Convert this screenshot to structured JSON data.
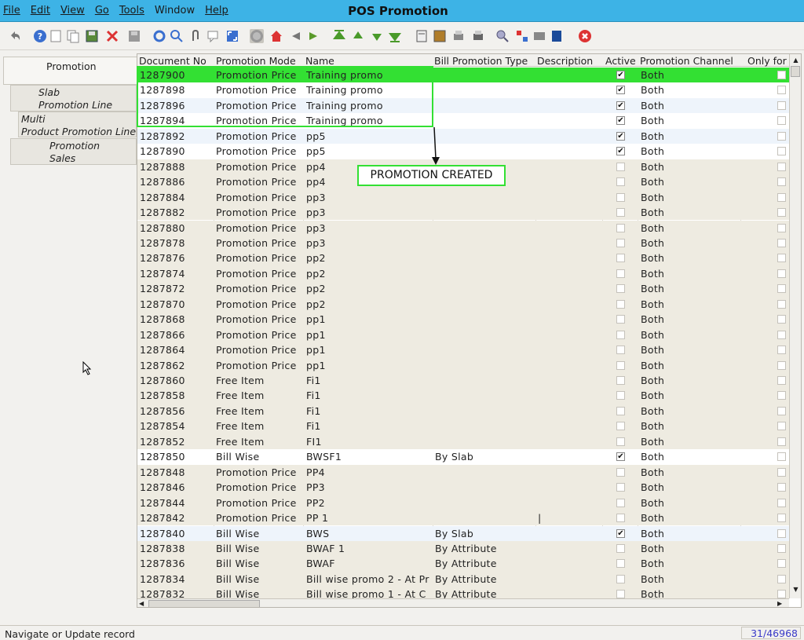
{
  "window": {
    "title": "POS Promotion"
  },
  "menu": [
    "File",
    "Edit",
    "View",
    "Go",
    "Tools",
    "Window",
    "Help"
  ],
  "toolbar_icons": [
    "undo-icon",
    "help-icon",
    "new-record-icon",
    "copy-record-icon",
    "save-record-icon",
    "delete-icon",
    "save-icon",
    "refresh-icon",
    "find-icon",
    "attachment-icon",
    "chat-icon",
    "grid-toggle-icon",
    "history-icon",
    "home-icon",
    "previous-icon",
    "next-icon",
    "first-record-icon",
    "previous-record-icon",
    "next-record-icon",
    "last-record-icon",
    "report-icon",
    "archive-icon",
    "print-preview-icon",
    "print-icon",
    "zoom-across-icon",
    "workflow-icon",
    "request-icon",
    "product-info-icon",
    "close-window-icon"
  ],
  "sidebar": {
    "tabs": [
      {
        "lines": [
          "Promotion"
        ]
      },
      {
        "lines": [
          "Slab",
          "Promotion Line"
        ]
      },
      {
        "lines": [
          "Multi",
          "Product Promotion Line"
        ]
      },
      {
        "lines": [
          "Promotion",
          "Sales"
        ]
      }
    ]
  },
  "table": {
    "columns": [
      "Document No",
      "Promotion Mode",
      "Name",
      "Bill Promotion Type",
      "Description",
      "Active",
      "Promotion Channel",
      "Only for ("
    ],
    "rows": [
      {
        "doc": "1287900",
        "mode": "Promotion Price",
        "name": "Training promo",
        "type": "",
        "desc": "",
        "active": true,
        "channel": "Both"
      },
      {
        "doc": "1287898",
        "mode": "Promotion Price",
        "name": "Training promo",
        "type": "",
        "desc": "",
        "active": true,
        "channel": "Both"
      },
      {
        "doc": "1287896",
        "mode": "Promotion Price",
        "name": "Training promo",
        "type": "",
        "desc": "",
        "active": true,
        "channel": "Both"
      },
      {
        "doc": "1287894",
        "mode": "Promotion Price",
        "name": "Training promo",
        "type": "",
        "desc": "",
        "active": true,
        "channel": "Both"
      },
      {
        "doc": "1287892",
        "mode": "Promotion Price",
        "name": "pp5",
        "type": "",
        "desc": "",
        "active": true,
        "channel": "Both"
      },
      {
        "doc": "1287890",
        "mode": "Promotion Price",
        "name": "pp5",
        "type": "",
        "desc": "",
        "active": true,
        "channel": "Both"
      },
      {
        "doc": "1287888",
        "mode": "Promotion Price",
        "name": "pp4",
        "type": "",
        "desc": "",
        "active": false,
        "channel": "Both"
      },
      {
        "doc": "1287886",
        "mode": "Promotion Price",
        "name": "pp4",
        "type": "",
        "desc": "",
        "active": false,
        "channel": "Both"
      },
      {
        "doc": "1287884",
        "mode": "Promotion Price",
        "name": "pp3",
        "type": "",
        "desc": "",
        "active": false,
        "channel": "Both"
      },
      {
        "doc": "1287882",
        "mode": "Promotion Price",
        "name": "pp3",
        "type": "",
        "desc": "",
        "active": false,
        "channel": "Both"
      },
      {
        "doc": "1287880",
        "mode": "Promotion Price",
        "name": "pp3",
        "type": "",
        "desc": "",
        "active": false,
        "channel": "Both"
      },
      {
        "doc": "1287878",
        "mode": "Promotion Price",
        "name": "pp3",
        "type": "",
        "desc": "",
        "active": false,
        "channel": "Both"
      },
      {
        "doc": "1287876",
        "mode": "Promotion Price",
        "name": "pp2",
        "type": "",
        "desc": "",
        "active": false,
        "channel": "Both"
      },
      {
        "doc": "1287874",
        "mode": "Promotion Price",
        "name": "pp2",
        "type": "",
        "desc": "",
        "active": false,
        "channel": "Both"
      },
      {
        "doc": "1287872",
        "mode": "Promotion Price",
        "name": "pp2",
        "type": "",
        "desc": "",
        "active": false,
        "channel": "Both"
      },
      {
        "doc": "1287870",
        "mode": "Promotion Price",
        "name": "pp2",
        "type": "",
        "desc": "",
        "active": false,
        "channel": "Both"
      },
      {
        "doc": "1287868",
        "mode": "Promotion Price",
        "name": "pp1",
        "type": "",
        "desc": "",
        "active": false,
        "channel": "Both"
      },
      {
        "doc": "1287866",
        "mode": "Promotion Price",
        "name": "pp1",
        "type": "",
        "desc": "",
        "active": false,
        "channel": "Both"
      },
      {
        "doc": "1287864",
        "mode": "Promotion Price",
        "name": "pp1",
        "type": "",
        "desc": "",
        "active": false,
        "channel": "Both"
      },
      {
        "doc": "1287862",
        "mode": "Promotion Price",
        "name": "pp1",
        "type": "",
        "desc": "",
        "active": false,
        "channel": "Both"
      },
      {
        "doc": "1287860",
        "mode": "Free Item",
        "name": "Fi1",
        "type": "",
        "desc": "",
        "active": false,
        "channel": "Both"
      },
      {
        "doc": "1287858",
        "mode": "Free Item",
        "name": "Fi1",
        "type": "",
        "desc": "",
        "active": false,
        "channel": "Both"
      },
      {
        "doc": "1287856",
        "mode": "Free Item",
        "name": "Fi1",
        "type": "",
        "desc": "",
        "active": false,
        "channel": "Both"
      },
      {
        "doc": "1287854",
        "mode": "Free Item",
        "name": "Fi1",
        "type": "",
        "desc": "",
        "active": false,
        "channel": "Both"
      },
      {
        "doc": "1287852",
        "mode": "Free Item",
        "name": "FI1",
        "type": "",
        "desc": "",
        "active": false,
        "channel": "Both"
      },
      {
        "doc": "1287850",
        "mode": "Bill Wise",
        "name": "BWSF1",
        "type": "By Slab",
        "desc": "",
        "active": true,
        "channel": "Both"
      },
      {
        "doc": "1287848",
        "mode": "Promotion Price",
        "name": "PP4",
        "type": "",
        "desc": "",
        "active": false,
        "channel": "Both"
      },
      {
        "doc": "1287846",
        "mode": "Promotion Price",
        "name": "PP3",
        "type": "",
        "desc": "",
        "active": false,
        "channel": "Both"
      },
      {
        "doc": "1287844",
        "mode": "Promotion Price",
        "name": "PP2",
        "type": "",
        "desc": "",
        "active": false,
        "channel": "Both"
      },
      {
        "doc": "1287842",
        "mode": "Promotion Price",
        "name": "PP 1",
        "type": "",
        "desc": "|",
        "active": false,
        "channel": "Both"
      },
      {
        "doc": "1287840",
        "mode": "Bill Wise",
        "name": "BWS",
        "type": "By Slab",
        "desc": "",
        "active": true,
        "channel": "Both"
      },
      {
        "doc": "1287838",
        "mode": "Bill Wise",
        "name": "BWAF 1",
        "type": "By Attribute",
        "desc": "",
        "active": false,
        "channel": "Both"
      },
      {
        "doc": "1287836",
        "mode": "Bill Wise",
        "name": "BWAF",
        "type": "By Attribute",
        "desc": "",
        "active": false,
        "channel": "Both"
      },
      {
        "doc": "1287834",
        "mode": "Bill Wise",
        "name": "Bill wise promo 2 - At Pr",
        "type": "By Attribute",
        "desc": "",
        "active": false,
        "channel": "Both"
      },
      {
        "doc": "1287832",
        "mode": "Bill Wise",
        "name": "Bill wise promo 1 - At C",
        "type": "By Attribute",
        "desc": "",
        "active": false,
        "channel": "Both"
      }
    ]
  },
  "annotation": {
    "callout": "PROMOTION CREATED",
    "color": "#33e033"
  },
  "status": {
    "text": "Navigate or Update record",
    "count": "31/46968"
  }
}
